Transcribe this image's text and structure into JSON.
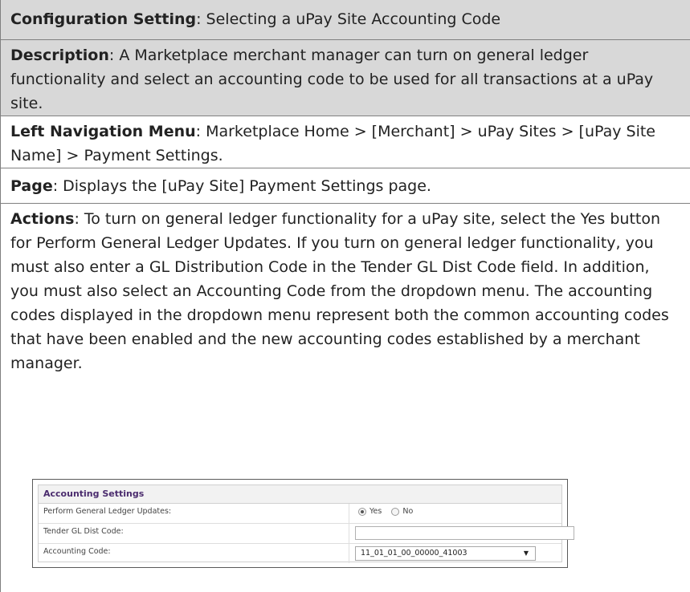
{
  "config": {
    "label": "Configuration Setting",
    "value": ": Selecting a uPay Site Accounting Code"
  },
  "description": {
    "label": "Description",
    "value": ": A Marketplace merchant manager can turn on general ledger functionality and select an accounting code to be used for all transactions at a uPay site."
  },
  "left_nav": {
    "label": "Left Navigation Menu",
    "value": ": Marketplace Home > [Merchant] > uPay Sites > [uPay Site Name] > Payment Settings."
  },
  "page": {
    "label": "Page",
    "value": ": Displays the [uPay Site] Payment Settings page."
  },
  "actions": {
    "label": "Actions",
    "value": ": To turn on general ledger functionality for a uPay site, select the Yes button for Perform General Ledger Updates. If you turn on general ledger functionality, you must also enter a GL Distribution Code in the Tender GL Dist Code field. In addition, you must also select an Accounting Code from the dropdown menu. The accounting codes displayed in the dropdown menu represent both the common accounting codes that have been enabled and the new accounting codes established by a merchant manager."
  },
  "panel": {
    "title": "Accounting Settings",
    "perform_label": "Perform General Ledger Updates:",
    "yes_label": "Yes",
    "no_label": "No",
    "yes_selected": true,
    "tender_label": "Tender GL Dist Code:",
    "tender_value": "",
    "accounting_label": "Accounting Code:",
    "accounting_value": "11_01_01_00_00000_41003"
  }
}
